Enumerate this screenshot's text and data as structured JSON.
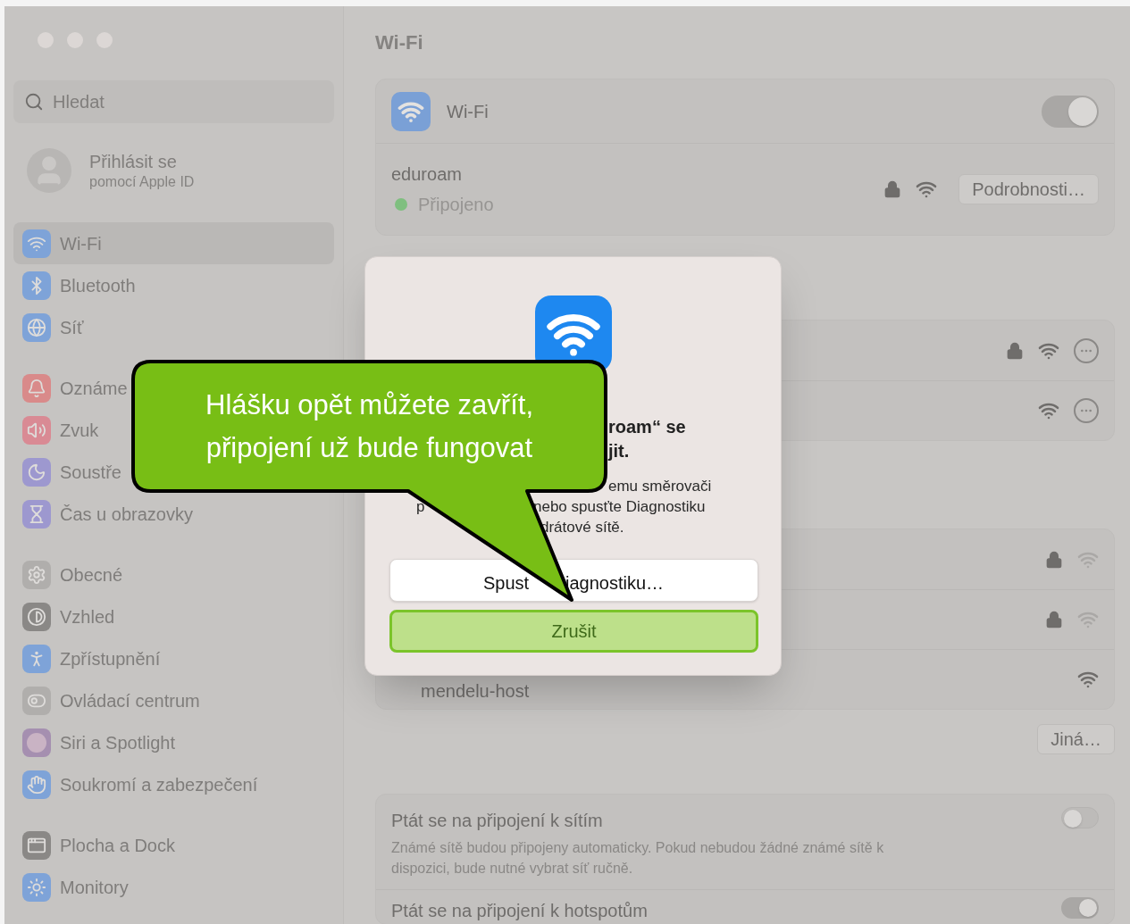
{
  "sidebar": {
    "search": {
      "placeholder": "Hledat"
    },
    "account": {
      "title": "Přihlásit se",
      "subtitle": "pomocí Apple ID"
    },
    "sections": [
      {
        "items": [
          {
            "label": "Wi-Fi",
            "selected": true,
            "color": "#7ea3d8"
          },
          {
            "label": "Bluetooth",
            "selected": false,
            "color": "#7ea3d8"
          },
          {
            "label": "Síť",
            "selected": false,
            "color": "#7ea3d8"
          }
        ]
      },
      {
        "items": [
          {
            "label": "Oznáme",
            "selected": false,
            "color": "#d98a8a"
          },
          {
            "label": "Zvuk",
            "selected": false,
            "color": "#d98a94"
          },
          {
            "label": "Soustře",
            "selected": false,
            "color": "#9d98cf"
          },
          {
            "label": "Čas u obrazovky",
            "selected": false,
            "color": "#9d98cf"
          }
        ]
      },
      {
        "items": [
          {
            "label": "Obecné",
            "selected": false,
            "color": "#b0aeac"
          },
          {
            "label": "Vzhled",
            "selected": false,
            "color": "#8a8886"
          },
          {
            "label": "Zpřístupnění",
            "selected": false,
            "color": "#7ea3d8"
          },
          {
            "label": "Ovládací centrum",
            "selected": false,
            "color": "#b0aeac"
          },
          {
            "label": "Siri a Spotlight",
            "selected": false,
            "color": "#a58fb0"
          },
          {
            "label": "Soukromí a zabezpečení",
            "selected": false,
            "color": "#7ea3d8"
          }
        ]
      },
      {
        "items": [
          {
            "label": "Plocha a Dock",
            "selected": false,
            "color": "#8a8886"
          },
          {
            "label": "Monitory",
            "selected": false,
            "color": "#7ea3d8"
          }
        ]
      }
    ]
  },
  "main": {
    "title": "Wi-Fi",
    "wifi": {
      "label": "Wi-Fi",
      "on": true
    },
    "current": {
      "name": "eduroam",
      "status": "Připojeno",
      "secured": true,
      "button": "Podrobnosti…"
    },
    "network_groups": [
      {
        "rows": [
          {
            "secured": true,
            "reachable": true,
            "more": true
          },
          {
            "secured": false,
            "reachable": true,
            "more": true
          }
        ]
      },
      {
        "rows": [
          {
            "secured": true,
            "reachable": false,
            "more": false
          },
          {
            "secured": true,
            "reachable": false,
            "more": false
          },
          {
            "name": "mendelu-host",
            "secured": false,
            "reachable": true,
            "more": false
          }
        ]
      }
    ],
    "other_button": "Jiná…",
    "settings": [
      {
        "title": "Ptát se na připojení k sítím",
        "description": "Známé sítě budou připojeny automaticky. Pokud nebudou žádné známé sítě k dispozici, bude nutné vybrat síť ručně.",
        "on": false
      },
      {
        "title": "Ptát se na připojení k hotspotům",
        "on": true
      }
    ]
  },
  "dialog": {
    "title_fragments": [
      "roam“ se",
      "jit."
    ],
    "body_fragments": [
      "emu směrovači",
      "p",
      "nebo spusťte Diagnostiku",
      "drátové sítě."
    ],
    "buttons": [
      {
        "kind": "secondary",
        "fragments": [
          "Spust",
          "iagnostiku…"
        ]
      },
      {
        "kind": "highlighted",
        "fragments": [
          "Zrušit"
        ]
      }
    ]
  },
  "callout": {
    "lines": [
      "Hlášku opět můžete zavřít,",
      "připojení už bude fungovat"
    ]
  }
}
